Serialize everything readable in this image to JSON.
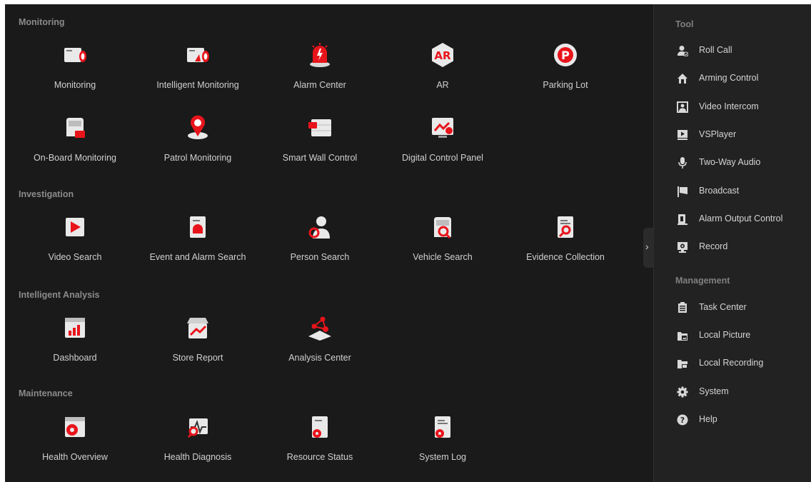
{
  "colors": {
    "accent": "#e8141b",
    "background": "#1a1a1a",
    "sidebar": "#222222"
  },
  "sections": {
    "monitoring": {
      "title": "Monitoring",
      "items": [
        "Monitoring",
        "Intelligent Monitoring",
        "Alarm Center",
        "AR",
        "Parking Lot",
        "On-Board Monitoring",
        "Patrol Monitoring",
        "Smart Wall Control",
        "Digital Control Panel"
      ],
      "icons": [
        "monitoring-icon",
        "intelligent-monitoring-icon",
        "alarm-siren-icon",
        "ar-icon",
        "parking-icon",
        "vehicle-camera-icon",
        "patrol-pin-icon",
        "smart-wall-icon",
        "control-panel-icon"
      ]
    },
    "investigation": {
      "title": "Investigation",
      "items": [
        "Video Search",
        "Event and Alarm Search",
        "Person Search",
        "Vehicle Search",
        "Evidence Collection"
      ],
      "icons": [
        "video-search-icon",
        "event-search-icon",
        "person-search-icon",
        "vehicle-search-icon",
        "evidence-icon"
      ]
    },
    "analysis": {
      "title": "Intelligent Analysis",
      "items": [
        "Dashboard",
        "Store Report",
        "Analysis Center"
      ],
      "icons": [
        "dashboard-icon",
        "store-report-icon",
        "analysis-center-icon"
      ]
    },
    "maintenance": {
      "title": "Maintenance",
      "items": [
        "Health Overview",
        "Health Diagnosis",
        "Resource Status",
        "System Log"
      ],
      "icons": [
        "health-overview-icon",
        "health-diagnosis-icon",
        "resource-status-icon",
        "system-log-icon"
      ]
    }
  },
  "sidebar": {
    "tool_title": "Tool",
    "tools": [
      "Roll Call",
      "Arming Control",
      "Video Intercom",
      "VSPlayer",
      "Two-Way Audio",
      "Broadcast",
      "Alarm Output Control",
      "Record"
    ],
    "tool_icons": [
      "roll-call-icon",
      "arming-control-icon",
      "video-intercom-icon",
      "vsplayer-icon",
      "microphone-icon",
      "broadcast-flag-icon",
      "alarm-output-icon",
      "record-icon"
    ],
    "management_title": "Management",
    "management": [
      "Task Center",
      "Local Picture",
      "Local Recording",
      "System",
      "Help"
    ],
    "management_icons": [
      "task-center-icon",
      "local-picture-icon",
      "local-recording-icon",
      "gear-icon",
      "help-icon"
    ]
  },
  "collapse": {
    "icon": "chevron-right-icon",
    "glyph": "›"
  }
}
